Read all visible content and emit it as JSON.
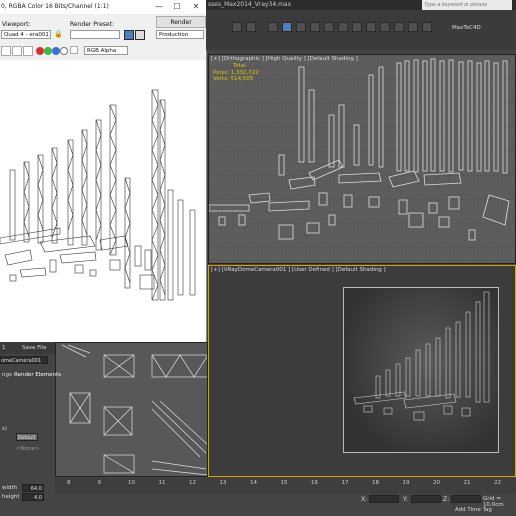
{
  "frame_buffer": {
    "title": "0, RGBA Color 16 Bits/Channel (1:1)",
    "viewport_label": "Viewport:",
    "viewport_value": "Quad 4 - era001",
    "render_preset_label": "Render Preset:",
    "render_preset_value": "",
    "render_button": "Render",
    "production_value": "Production",
    "channel_value": "RGB Alpha",
    "window_minimize": "—",
    "window_maximize": "☐",
    "window_close": "✕"
  },
  "max_window": {
    "title": "sses_Max2014_Vray34.max",
    "search_placeholder": "Type a keyword or phrase",
    "plugin_label": "MaxToC4D"
  },
  "viewports": {
    "top": {
      "label": "[+] [Orthographic ] [High Quality ] [Default Shading ]",
      "stats_total": "Total",
      "stats_polys_label": "Polys:",
      "stats_polys_value": "1,332,722",
      "stats_verts_label": "Verts:",
      "stats_verts_value": "514,505"
    },
    "perspective": {
      "label": "[+] [VRayDomeCamera001 ] [User Defined ] [Default Shading ]"
    }
  },
  "command_panel": {
    "top_left": "1",
    "save_file": "Save File",
    "camera_value": "omeCamera001",
    "tab_settings": "ngs",
    "tab_render_elements": "Render Elements",
    "section_paren": "s)",
    "default_button": "Default",
    "none_value": "<None>",
    "width_label": "width",
    "width_value": "64.0",
    "height_label": "height",
    "height_value": "4.0"
  },
  "timeline": {
    "ticks": [
      "8",
      "9",
      "10",
      "11",
      "12",
      "13",
      "14",
      "15",
      "16",
      "17",
      "18",
      "19",
      "20",
      "21",
      "22"
    ],
    "x_label": "X:",
    "y_label": "Y:",
    "z_label": "Z:",
    "grid": "Grid = 10,0cm",
    "add_time_tag": "Add Time Tag"
  },
  "colors": {
    "accent_active_viewport": "#d2a600",
    "stats_text": "#e0c600",
    "toolbar_active": "#4f7fb8"
  }
}
